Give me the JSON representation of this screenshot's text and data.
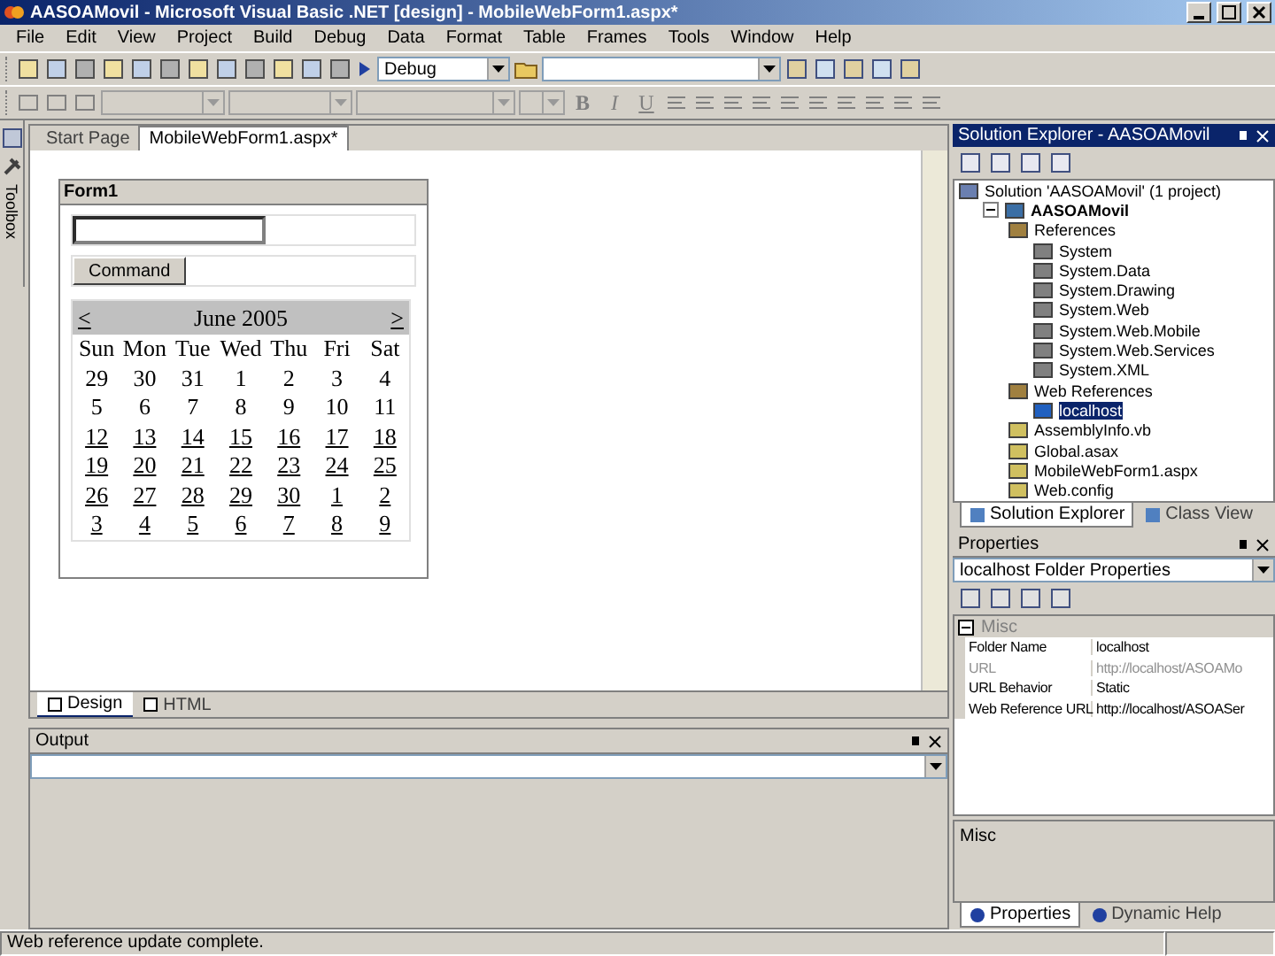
{
  "window": {
    "title": "AASOAMovil - Microsoft Visual Basic .NET [design] - MobileWebForm1.aspx*"
  },
  "menu": [
    "File",
    "Edit",
    "View",
    "Project",
    "Build",
    "Debug",
    "Data",
    "Format",
    "Table",
    "Frames",
    "Tools",
    "Window",
    "Help"
  ],
  "toolbar": {
    "configuration": "Debug"
  },
  "format_toolbar": {
    "bold": "B",
    "italic": "I",
    "underline": "U"
  },
  "toolbox": {
    "label": "Toolbox"
  },
  "editor_tabs": [
    {
      "label": "Start Page",
      "selected": false
    },
    {
      "label": "MobileWebForm1.aspx*",
      "selected": true
    }
  ],
  "form": {
    "title": "Form1",
    "command": "Command",
    "calendar": {
      "prev": "<",
      "next": ">",
      "month": "June 2005",
      "days": [
        "Sun",
        "Mon",
        "Tue",
        "Wed",
        "Thu",
        "Fri",
        "Sat"
      ],
      "weeks": [
        {
          "underlined": false,
          "dates": [
            "29",
            "30",
            "31",
            "1",
            "2",
            "3",
            "4"
          ]
        },
        {
          "underlined": false,
          "dates": [
            "5",
            "6",
            "7",
            "8",
            "9",
            "10",
            "11"
          ]
        },
        {
          "underlined": true,
          "dates": [
            "12",
            "13",
            "14",
            "15",
            "16",
            "17",
            "18"
          ]
        },
        {
          "underlined": true,
          "dates": [
            "19",
            "20",
            "21",
            "22",
            "23",
            "24",
            "25"
          ]
        },
        {
          "underlined": true,
          "dates": [
            "26",
            "27",
            "28",
            "29",
            "30",
            "1",
            "2"
          ]
        },
        {
          "underlined": true,
          "dates": [
            "3",
            "4",
            "5",
            "6",
            "7",
            "8",
            "9"
          ]
        }
      ]
    }
  },
  "view_tabs": [
    {
      "label": "Design",
      "selected": true
    },
    {
      "label": "HTML",
      "selected": false
    }
  ],
  "output": {
    "title": "Output"
  },
  "solution_explorer": {
    "title": "Solution Explorer - AASOAMovil",
    "tree": [
      {
        "label": "Solution 'AASOAMovil' (1 project)",
        "kind": "solution",
        "children": [
          {
            "label": "AASOAMovil",
            "kind": "project",
            "expanded": true,
            "children": [
              {
                "label": "References",
                "kind": "references",
                "children": [
                  {
                    "label": "System",
                    "kind": "reference"
                  },
                  {
                    "label": "System.Data",
                    "kind": "reference"
                  },
                  {
                    "label": "System.Drawing",
                    "kind": "reference"
                  },
                  {
                    "label": "System.Web",
                    "kind": "reference"
                  },
                  {
                    "label": "System.Web.Mobile",
                    "kind": "reference"
                  },
                  {
                    "label": "System.Web.Services",
                    "kind": "reference"
                  },
                  {
                    "label": "System.XML",
                    "kind": "reference"
                  }
                ]
              },
              {
                "label": "Web References",
                "kind": "webrefs",
                "children": [
                  {
                    "label": "localhost",
                    "kind": "webref",
                    "selected": true
                  }
                ]
              },
              {
                "label": "AssemblyInfo.vb",
                "kind": "file"
              },
              {
                "label": "Global.asax",
                "kind": "file"
              },
              {
                "label": "MobileWebForm1.aspx",
                "kind": "file"
              },
              {
                "label": "Web.config",
                "kind": "file"
              }
            ]
          }
        ]
      }
    ],
    "tabs": [
      {
        "label": "Solution Explorer",
        "selected": true
      },
      {
        "label": "Class View",
        "selected": false
      }
    ]
  },
  "properties": {
    "title": "Properties",
    "object": "localhost  Folder Properties",
    "category": "Misc",
    "rows": [
      {
        "name": "Folder Name",
        "value": "localhost",
        "disabled": false
      },
      {
        "name": "URL",
        "value": "http://localhost/ASOAMo",
        "disabled": true
      },
      {
        "name": "URL Behavior",
        "value": "Static",
        "disabled": false
      },
      {
        "name": "Web Reference URL",
        "value": "http://localhost/ASOASer",
        "disabled": false
      }
    ],
    "description": "Misc",
    "tabs": [
      {
        "label": "Properties",
        "selected": true
      },
      {
        "label": "Dynamic Help",
        "selected": false
      }
    ]
  },
  "status_bar": "Web reference update complete."
}
